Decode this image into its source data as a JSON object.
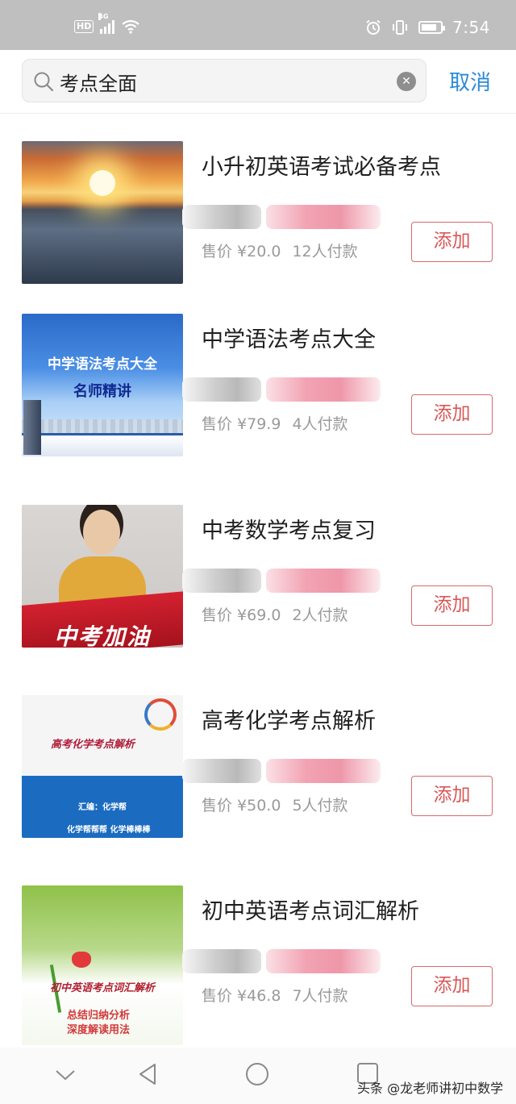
{
  "status_bar": {
    "hd": "HD",
    "network": "4G",
    "time": "7:54"
  },
  "search": {
    "query": "考点全面",
    "cancel_label": "取消"
  },
  "results": [
    {
      "title": "小升初英语考试必备考点",
      "price": "售价 ¥20.0",
      "buyers": "12人付款",
      "add_label": "添加"
    },
    {
      "title": "中学语法考点大全",
      "price": "售价 ¥79.9",
      "buyers": "4人付款",
      "add_label": "添加",
      "thumb_lines": [
        "中学语法考点大全",
        "名师精讲"
      ]
    },
    {
      "title": "中考数学考点复习",
      "price": "售价 ¥69.0",
      "buyers": "2人付款",
      "add_label": "添加",
      "thumb_text": "中考加油"
    },
    {
      "title": "高考化学考点解析",
      "price": "售价 ¥50.0",
      "buyers": "5人付款",
      "add_label": "添加",
      "thumb_title": "高考化学考点解析",
      "thumb_lines": [
        "汇编：化学帮",
        "化学帮帮帮  化学棒棒棒"
      ]
    },
    {
      "title": "初中英语考点词汇解析",
      "price": "售价 ¥46.8",
      "buyers": "7人付款",
      "add_label": "添加",
      "thumb_title": "初中英语考点词汇解析",
      "thumb_lines": [
        "总结归纳分析",
        "深度解读用法"
      ]
    }
  ],
  "watermark": "头条 @龙老师讲初中数学",
  "colors": {
    "accent_blue": "#2b8ad8",
    "add_red": "#d85858",
    "status_bar": "#bfbfbf"
  }
}
